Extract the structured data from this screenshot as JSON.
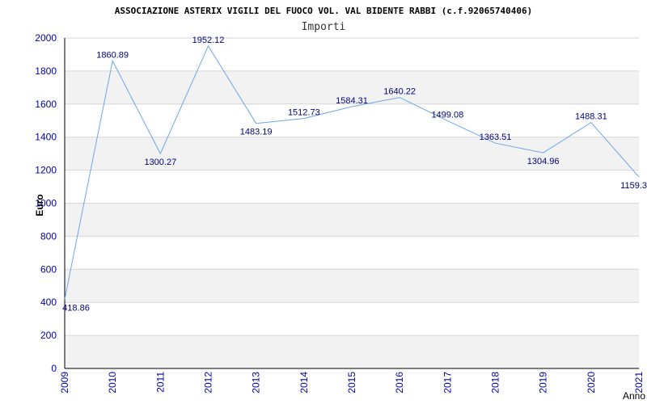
{
  "title": "ASSOCIAZIONE ASTERIX VIGILI DEL FUOCO VOL. VAL BIDENTE RABBI (c.f.92065740406)",
  "subtitle": "Importi",
  "colors": {
    "line": "#6aa7e6",
    "band": "#f2f2f2",
    "tick_text": "#0000aa",
    "label_text": "#000080",
    "axis": "#000000",
    "grid": "#d6d6d6"
  },
  "chart_data": {
    "type": "line",
    "title": "ASSOCIAZIONE ASTERIX VIGILI DEL FUOCO VOL. VAL BIDENTE RABBI (c.f.92065740406)",
    "subtitle": "Importi",
    "xlabel": "Anno",
    "ylabel": "Euro",
    "xlim": [
      2009,
      2021
    ],
    "ylim": [
      0,
      2000
    ],
    "y_ticks": [
      0,
      200,
      400,
      600,
      800,
      1000,
      1200,
      1400,
      1600,
      1800,
      2000
    ],
    "x": [
      2009,
      2010,
      2011,
      2012,
      2013,
      2014,
      2015,
      2016,
      2017,
      2018,
      2019,
      2020,
      2021
    ],
    "values": [
      418.86,
      1860.89,
      1300.27,
      1952.12,
      1483.19,
      1512.73,
      1584.31,
      1640.22,
      1499.08,
      1363.51,
      1304.96,
      1488.31,
      1159.3
    ],
    "labels": [
      "418.86",
      "1860.89",
      "1300.27",
      "1952.12",
      "1483.19",
      "1512.73",
      "1584.31",
      "1640.22",
      "1499.08",
      "1363.51",
      "1304.96",
      "1488.31",
      "1159.3"
    ],
    "grid": true,
    "legend": "none"
  }
}
